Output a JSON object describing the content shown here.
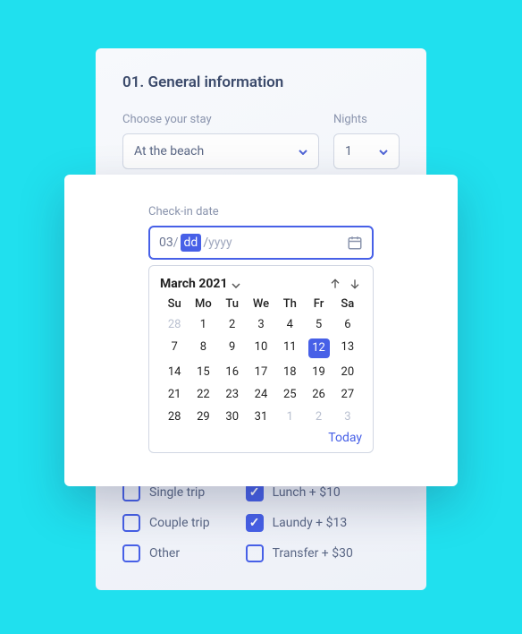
{
  "section": {
    "title": "01. General information"
  },
  "stay": {
    "label": "Choose your stay",
    "value": "At the beach"
  },
  "nights": {
    "label": "Nights",
    "value": "1"
  },
  "checkin": {
    "label": "Check-in date",
    "mm": "03",
    "sep": " / ",
    "dd": "dd",
    "yyyy": "yyyy"
  },
  "calendar": {
    "month_label": "March 2021",
    "dow": [
      "Su",
      "Mo",
      "Tu",
      "We",
      "Th",
      "Fr",
      "Sa"
    ],
    "days": [
      {
        "n": "28",
        "muted": true
      },
      {
        "n": "1"
      },
      {
        "n": "2"
      },
      {
        "n": "3"
      },
      {
        "n": "4"
      },
      {
        "n": "5"
      },
      {
        "n": "6"
      },
      {
        "n": "7"
      },
      {
        "n": "8"
      },
      {
        "n": "9"
      },
      {
        "n": "10"
      },
      {
        "n": "11"
      },
      {
        "n": "12",
        "selected": true
      },
      {
        "n": "13"
      },
      {
        "n": "14"
      },
      {
        "n": "15"
      },
      {
        "n": "16"
      },
      {
        "n": "17"
      },
      {
        "n": "18"
      },
      {
        "n": "19"
      },
      {
        "n": "20"
      },
      {
        "n": "21"
      },
      {
        "n": "22"
      },
      {
        "n": "23"
      },
      {
        "n": "24"
      },
      {
        "n": "25"
      },
      {
        "n": "26"
      },
      {
        "n": "27"
      },
      {
        "n": "28"
      },
      {
        "n": "29"
      },
      {
        "n": "30"
      },
      {
        "n": "31"
      },
      {
        "n": "1",
        "muted": true
      },
      {
        "n": "2",
        "muted": true
      },
      {
        "n": "3",
        "muted": true
      }
    ],
    "today_label": "Today"
  },
  "options": {
    "left": [
      {
        "label": "Single trip",
        "checked": false
      },
      {
        "label": "Couple trip",
        "checked": false
      },
      {
        "label": "Other",
        "checked": false
      }
    ],
    "right": [
      {
        "label": "Lunch + $10",
        "checked": true
      },
      {
        "label": "Laundy + $13",
        "checked": true
      },
      {
        "label": "Transfer + $30",
        "checked": false
      }
    ]
  }
}
